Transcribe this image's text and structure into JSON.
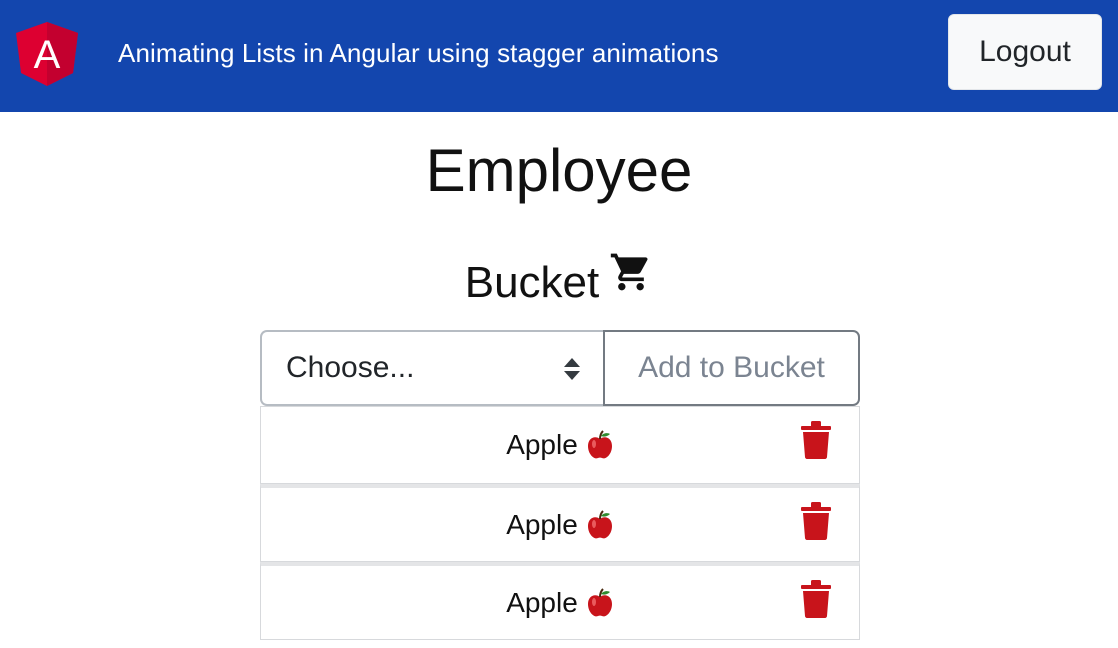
{
  "navbar": {
    "logo_letter": "A",
    "title": "Animating Lists in Angular using stagger animations",
    "logout_label": "Logout",
    "background": "#1346ae"
  },
  "page": {
    "heading": "Employee",
    "subheading": "Bucket",
    "cart_icon": "shopping-cart-icon"
  },
  "bucket_form": {
    "select_value": "Choose...",
    "add_button_label": "Add to Bucket"
  },
  "bucket_items": [
    {
      "label": "Apple",
      "icon": "apple-icon"
    },
    {
      "label": "Apple",
      "icon": "apple-icon"
    },
    {
      "label": "Apple",
      "icon": "apple-icon"
    }
  ],
  "colors": {
    "delete_icon": "#c8141b",
    "apple": "#c8141b"
  }
}
